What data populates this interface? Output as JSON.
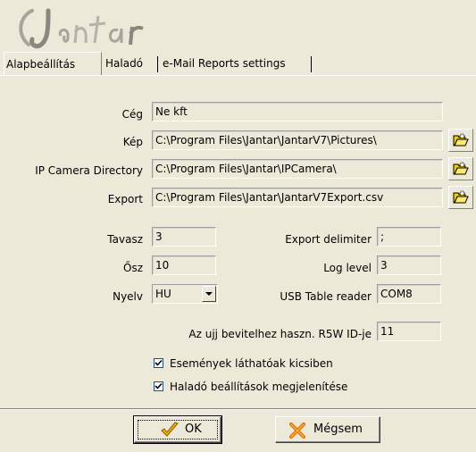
{
  "logo_text": "Jantar",
  "tabs": [
    {
      "label": "Alapbeállítás",
      "active": true
    },
    {
      "label": "Haladó",
      "active": false
    },
    {
      "label": "e-Mail Reports settings",
      "active": false
    }
  ],
  "fields": {
    "ceg": {
      "label": "Cég",
      "value": "Ne kft"
    },
    "kep": {
      "label": "Kép",
      "value": "C:\\Program Files\\Jantar\\JantarV7\\Pictures\\"
    },
    "ipcam": {
      "label": "IP Camera Directory",
      "value": "C:\\Program Files\\Jantar\\IPCamera\\"
    },
    "export": {
      "label": "Export",
      "value": "C:\\Program Files\\Jantar\\JantarV7Export.csv"
    },
    "tavasz": {
      "label": "Tavasz",
      "value": "3"
    },
    "osz": {
      "label": "Ősz",
      "value": "10"
    },
    "nyelv": {
      "label": "Nyelv",
      "value": "HU"
    },
    "export_delimiter": {
      "label": "Export delimiter",
      "value": ";"
    },
    "log_level": {
      "label": "Log level",
      "value": "3"
    },
    "usb_reader": {
      "label": "USB Table reader",
      "value": "COM8"
    },
    "r5w_id": {
      "label": "Az ujj bevitelhez haszn. R5W ID-je",
      "value": "11"
    }
  },
  "checkboxes": [
    {
      "label": "Események láthatóak kicsiben",
      "checked": true
    },
    {
      "label": "Haladó beállítások megjelenítése",
      "checked": true
    }
  ],
  "buttons": {
    "ok": {
      "label": "OK",
      "icon": "checkmark-icon"
    },
    "cancel": {
      "label": "Mégsem",
      "icon": "x-icon"
    }
  },
  "icons": {
    "browse": "folder-open-icon",
    "dropdown": "chevron-down-icon"
  },
  "colors": {
    "dialog_bg": "#ece9d8",
    "folder_yellow": "#f5d200",
    "ok_check": "#e8a000",
    "cancel_x": "#e07000"
  }
}
